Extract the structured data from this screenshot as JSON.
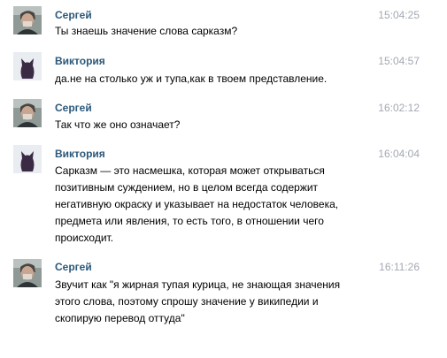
{
  "messages": [
    {
      "author": "Сергей",
      "time": "15:04:25",
      "lines": [
        "Ты знаешь значение слова сарказм?"
      ],
      "avatar": "man-photo-avatar"
    },
    {
      "author": "Виктория",
      "time": "15:04:57",
      "lines": [
        "да.не на столько уж и тупа,как в твоем представление."
      ],
      "avatar": "cat-silhouette-avatar"
    },
    {
      "author": "Сергей",
      "time": "16:02:12",
      "lines": [
        "Так что же оно означает?"
      ],
      "avatar": "man-photo-avatar"
    },
    {
      "author": "Виктория",
      "time": "16:04:04",
      "lines": [
        "Сарказм — это насмешка, которая может открываться",
        "позитивным суждением, но в целом всегда содержит",
        "негативную окраску и указывает на недостаток человека,",
        "предмета или явления, то есть того, в отношении чего",
        "происходит."
      ],
      "avatar": "cat-silhouette-avatar"
    },
    {
      "author": "Сергей",
      "time": "16:11:26",
      "lines": [
        "Звучит как \"я жирная тупая курица, не знающая значения",
        "этого слова, поэтому спрошу значение у википедии и",
        "скопирую перевод оттуда\""
      ],
      "avatar": "man-photo-avatar"
    }
  ],
  "colors": {
    "author": "#2b587a",
    "time": "#a3a9b3",
    "text": "#000000",
    "cat_bg": "#e9edf2",
    "cat": "#3a2a44"
  }
}
